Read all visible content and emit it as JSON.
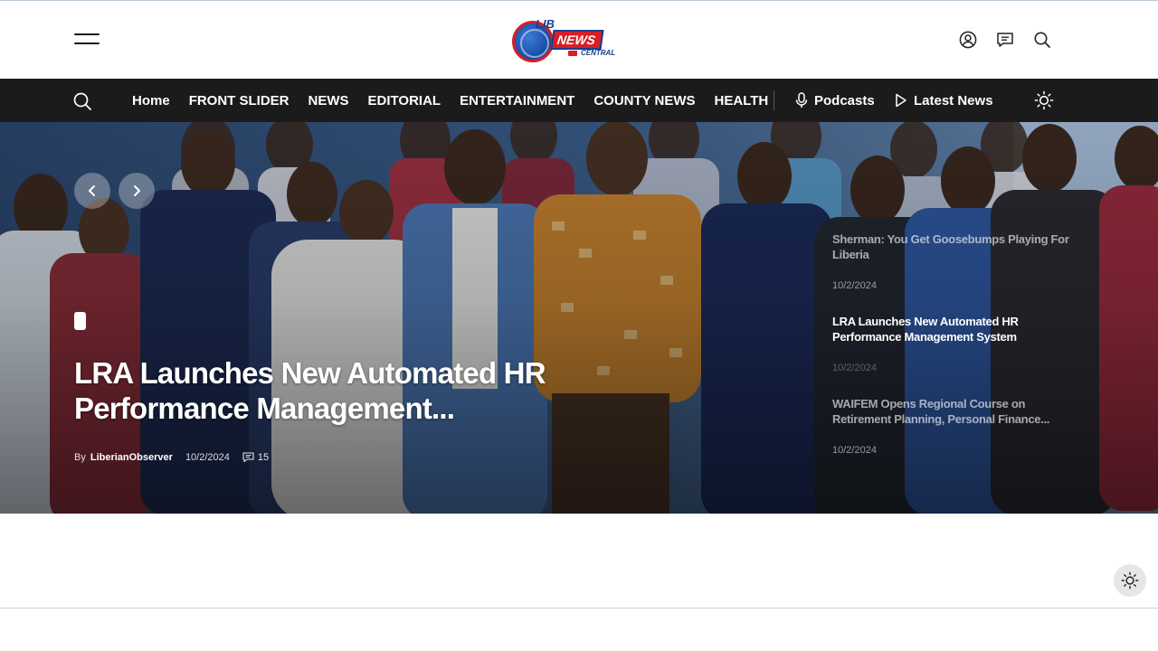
{
  "header": {
    "logo": {
      "lib": "LIB",
      "news": "NEWS",
      "central": "CENTRAL"
    },
    "icons": [
      "user-icon",
      "comment-icon",
      "search-icon"
    ]
  },
  "nav": {
    "items": [
      "Home",
      "FRONT SLIDER",
      "NEWS",
      "EDITORIAL",
      "ENTERTAINMENT",
      "COUNTY NEWS",
      "HEALTH"
    ],
    "podcasts": "Podcasts",
    "latest": "Latest News"
  },
  "hero": {
    "title": "LRA Launches New Automated HR Performance Management...",
    "by": "By",
    "author": "LiberianObserver",
    "date": "10/2/2024",
    "comments": "15"
  },
  "side": [
    {
      "title": "Sherman: You Get Goosebumps Playing For Liberia",
      "date": "10/2/2024",
      "faded": true
    },
    {
      "title": "LRA Launches New Automated HR Performance Management System",
      "date": "10/2/2024",
      "faded": false
    },
    {
      "title": "WAIFEM Opens Regional Course on Retirement Planning, Personal Finance...",
      "date": "10/2/2024",
      "faded": true
    }
  ],
  "colors": {
    "nav_bg": "#1b1b1b",
    "brand_red": "#d61f26",
    "brand_blue": "#1a3d8f"
  }
}
